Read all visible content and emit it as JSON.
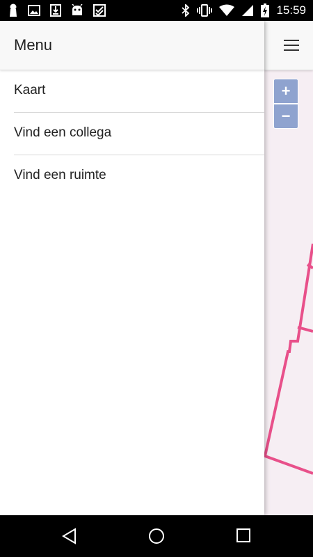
{
  "status_bar": {
    "time": "15:59",
    "left_icons": [
      "keyhole-icon",
      "image-icon",
      "download-icon",
      "android-icon",
      "tasks-icon"
    ],
    "right_icons": [
      "bluetooth-icon",
      "vibrate-icon",
      "wifi-icon",
      "signal-icon",
      "battery-icon"
    ]
  },
  "drawer": {
    "title": "Menu",
    "items": [
      {
        "label": "Kaart"
      },
      {
        "label": "Vind een collega"
      },
      {
        "label": "Vind een ruimte"
      }
    ]
  },
  "map": {
    "zoom_in_label": "+",
    "zoom_out_label": "−",
    "floor_plan_color": "#e8508a"
  },
  "nav_bar": {
    "buttons": [
      "back-icon",
      "home-icon",
      "recents-icon"
    ]
  }
}
